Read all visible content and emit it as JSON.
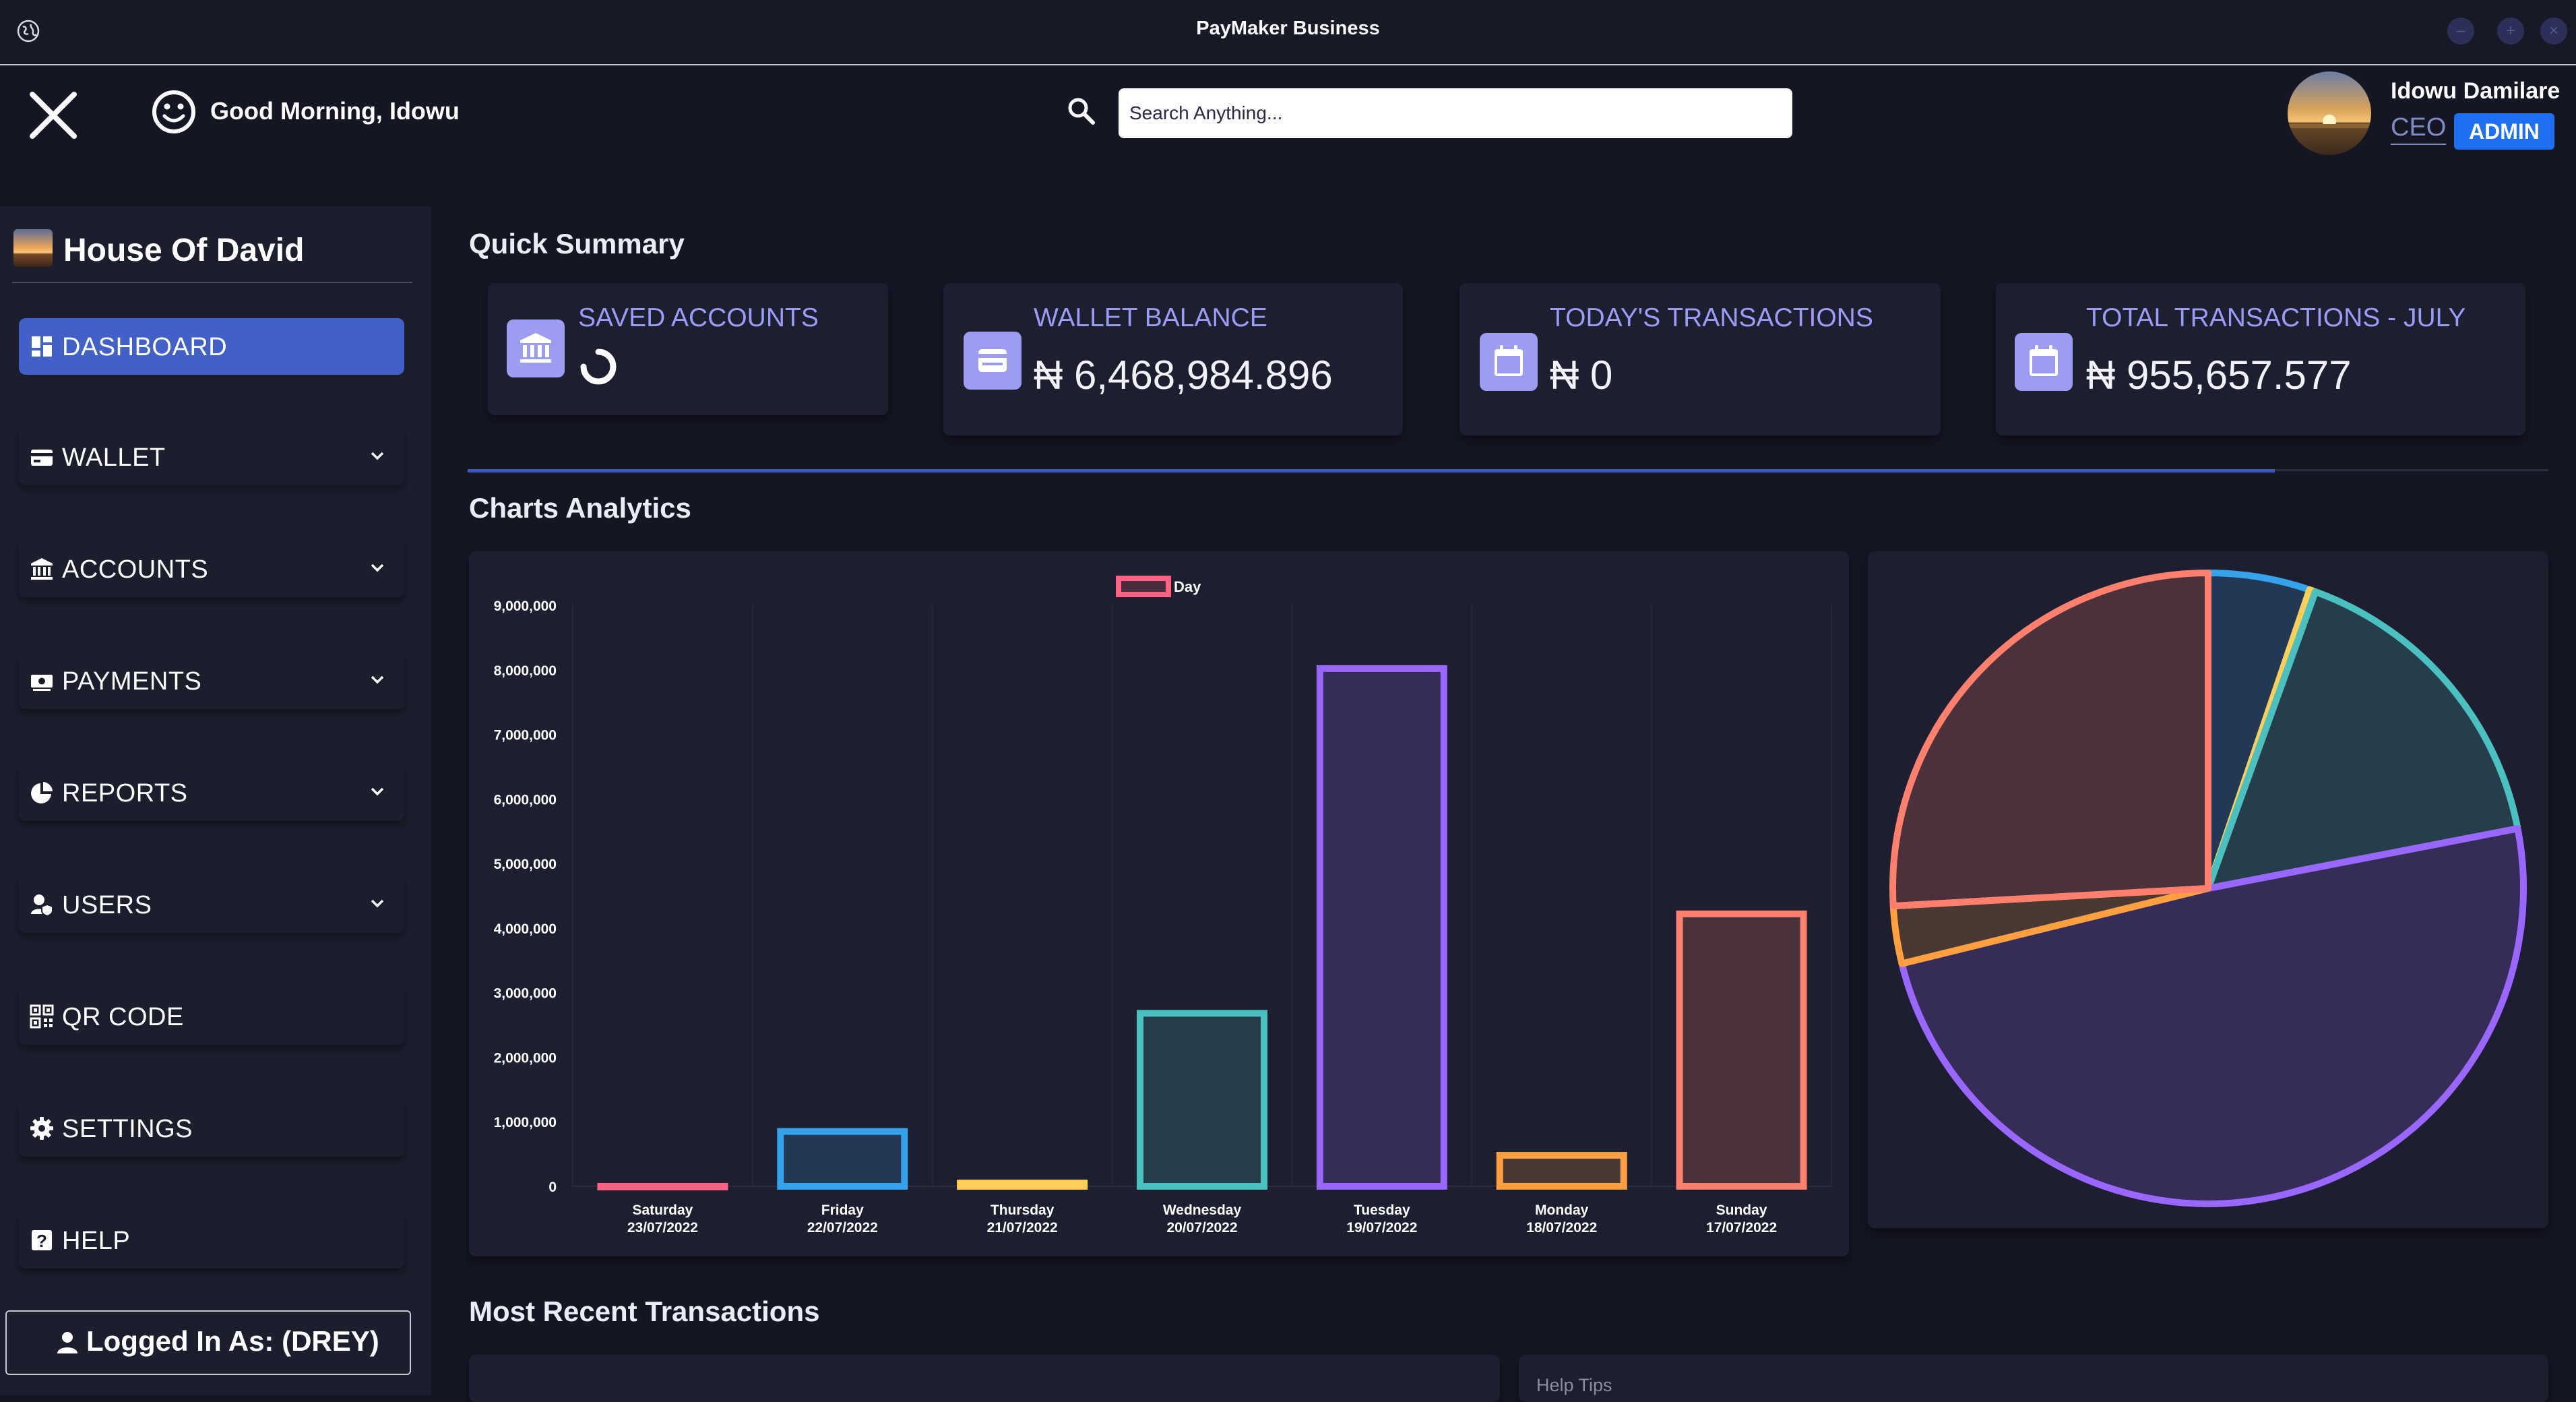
{
  "window": {
    "title": "PayMaker Business"
  },
  "header": {
    "greeting": "Good Morning, Idowu",
    "search_placeholder": "Search Anything...",
    "user": {
      "name": "Idowu Damilare",
      "role": "CEO",
      "badge": "ADMIN"
    }
  },
  "sidebar": {
    "org_name": "House Of David",
    "items": [
      {
        "label": "DASHBOARD",
        "icon": "dashboard-icon",
        "active": true,
        "expandable": false
      },
      {
        "label": "WALLET",
        "icon": "wallet-icon",
        "active": false,
        "expandable": true
      },
      {
        "label": "ACCOUNTS",
        "icon": "bank-icon",
        "active": false,
        "expandable": true
      },
      {
        "label": "PAYMENTS",
        "icon": "cash-icon",
        "active": false,
        "expandable": true
      },
      {
        "label": "REPORTS",
        "icon": "pie-chart-icon",
        "active": false,
        "expandable": true
      },
      {
        "label": "USERS",
        "icon": "user-shield-icon",
        "active": false,
        "expandable": true
      },
      {
        "label": "QR CODE",
        "icon": "qr-code-icon",
        "active": false,
        "expandable": false
      },
      {
        "label": "SETTINGS",
        "icon": "gear-icon",
        "active": false,
        "expandable": false
      },
      {
        "label": "HELP",
        "icon": "help-icon",
        "active": false,
        "expandable": false
      }
    ],
    "logged_in_label": "Logged In As: (DREY)"
  },
  "summary": {
    "title": "Quick Summary",
    "cards": [
      {
        "title": "SAVED ACCOUNTS",
        "value": "",
        "icon": "bank-icon",
        "loading": true
      },
      {
        "title": "WALLET BALANCE",
        "value": "₦ 6,468,984.896",
        "icon": "wallet-icon"
      },
      {
        "title": "TODAY'S TRANSACTIONS",
        "value": "₦ 0",
        "icon": "calendar-icon"
      },
      {
        "title": "TOTAL TRANSACTIONS - JULY",
        "value": "₦ 955,657.577",
        "icon": "calendar-icon"
      }
    ],
    "progress": 0.87
  },
  "analytics": {
    "title": "Charts Analytics"
  },
  "recent": {
    "title": "Most Recent Transactions",
    "help_title": "Help Tips"
  },
  "colors": {
    "accent": "#4360c9",
    "card_title": "#9a9cf6",
    "badge": "#1e6ff2",
    "series": [
      "#ff6384",
      "#36a2eb",
      "#ffce56",
      "#4bc0c0",
      "#9966ff",
      "#ff9f40",
      "#ff7f6e"
    ]
  },
  "chart_data": [
    {
      "type": "bar",
      "legend": [
        "Day"
      ],
      "legend_position": "top-center",
      "categories": [
        [
          "Saturday",
          "23/07/2022"
        ],
        [
          "Friday",
          "22/07/2022"
        ],
        [
          "Thursday",
          "21/07/2022"
        ],
        [
          "Wednesday",
          "20/07/2022"
        ],
        [
          "Tuesday",
          "19/07/2022"
        ],
        [
          "Monday",
          "18/07/2022"
        ],
        [
          "Sunday",
          "17/07/2022"
        ]
      ],
      "series": [
        {
          "name": "Day",
          "values": [
            0,
            850000,
            50000,
            2680000,
            8020000,
            480000,
            4220000
          ]
        }
      ],
      "ylim": [
        0,
        9000000
      ],
      "yticks": [
        "0",
        "1,000,000",
        "2,000,000",
        "3,000,000",
        "4,000,000",
        "5,000,000",
        "6,000,000",
        "7,000,000",
        "8,000,000",
        "9,000,000"
      ],
      "grid": true
    },
    {
      "type": "pie",
      "values": [
        0,
        850000,
        50000,
        2680000,
        8020000,
        480000,
        4220000
      ],
      "colors": [
        "#ff6384",
        "#36a2eb",
        "#ffce56",
        "#4bc0c0",
        "#9966ff",
        "#ff9f40",
        "#ff7f6e"
      ]
    }
  ]
}
